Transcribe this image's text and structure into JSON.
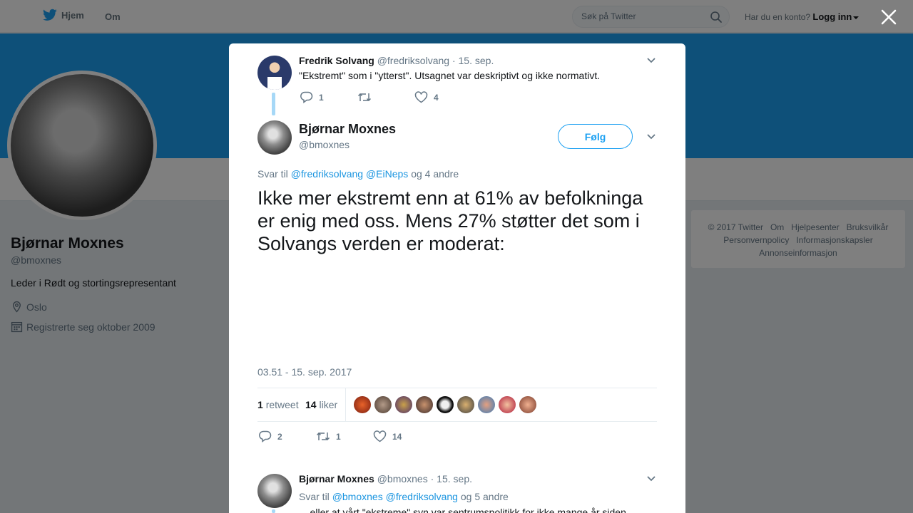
{
  "nav": {
    "home_label": "Hjem",
    "about_label": "Om",
    "search_placeholder": "Søk på Twitter",
    "account_prompt": "Har du en konto?",
    "login_label": "Logg inn"
  },
  "profile": {
    "name": "Bjørnar Moxnes",
    "handle": "@bmoxnes",
    "bio": "Leder i Rødt og stortingsrepresentant",
    "location": "Oslo",
    "joined": "Registrerte seg oktober 2009"
  },
  "footer": {
    "links": [
      "© 2017 Twitter",
      "Om",
      "Hjelpesenter",
      "Bruksvilkår",
      "Personvernpolicy",
      "Informasjonskapsler",
      "Annonseinformasjon"
    ]
  },
  "parent_tweet": {
    "name": "Fredrik Solvang",
    "handle": "@fredriksolvang",
    "date": "· 15. sep.",
    "text": "\"Ekstremt\" som i \"ytterst\". Utsagnet var deskriptivt og ikke normativt.",
    "replies": "1",
    "retweets": "",
    "likes": "4"
  },
  "main_tweet": {
    "name": "Bjørnar Moxnes",
    "handle": "@bmoxnes",
    "follow_label": "Følg",
    "reply_prefix": "Svar til",
    "reply_mention1": "@fredriksolvang",
    "reply_mention2": "@EiNeps",
    "reply_suffix": "og 4 andre",
    "text": "Ikke mer ekstremt enn at 61% av befolkninga er enig med oss. Mens 27% støtter det som i Solvangs verden er moderat:",
    "timestamp": "03.51 - 15. sep. 2017",
    "retweet_count": "1",
    "retweet_label": "retweet",
    "like_count": "14",
    "like_label": "liker",
    "replies": "2",
    "retweets": "1",
    "likes": "14"
  },
  "reply_tweet": {
    "name": "Bjørnar Moxnes",
    "handle": "@bmoxnes",
    "date": "· 15. sep.",
    "reply_prefix": "Svar til",
    "reply_mention1": "@bmoxnes",
    "reply_mention2": "@fredriksolvang",
    "reply_suffix": "og 5 andre",
    "text": "... eller at vårt \"ekstreme\" syn var sentrumspolitikk for ikke mange år siden."
  },
  "colors": {
    "accent": "#1da1f2",
    "link": "#1b95e0",
    "muted": "#657786"
  }
}
